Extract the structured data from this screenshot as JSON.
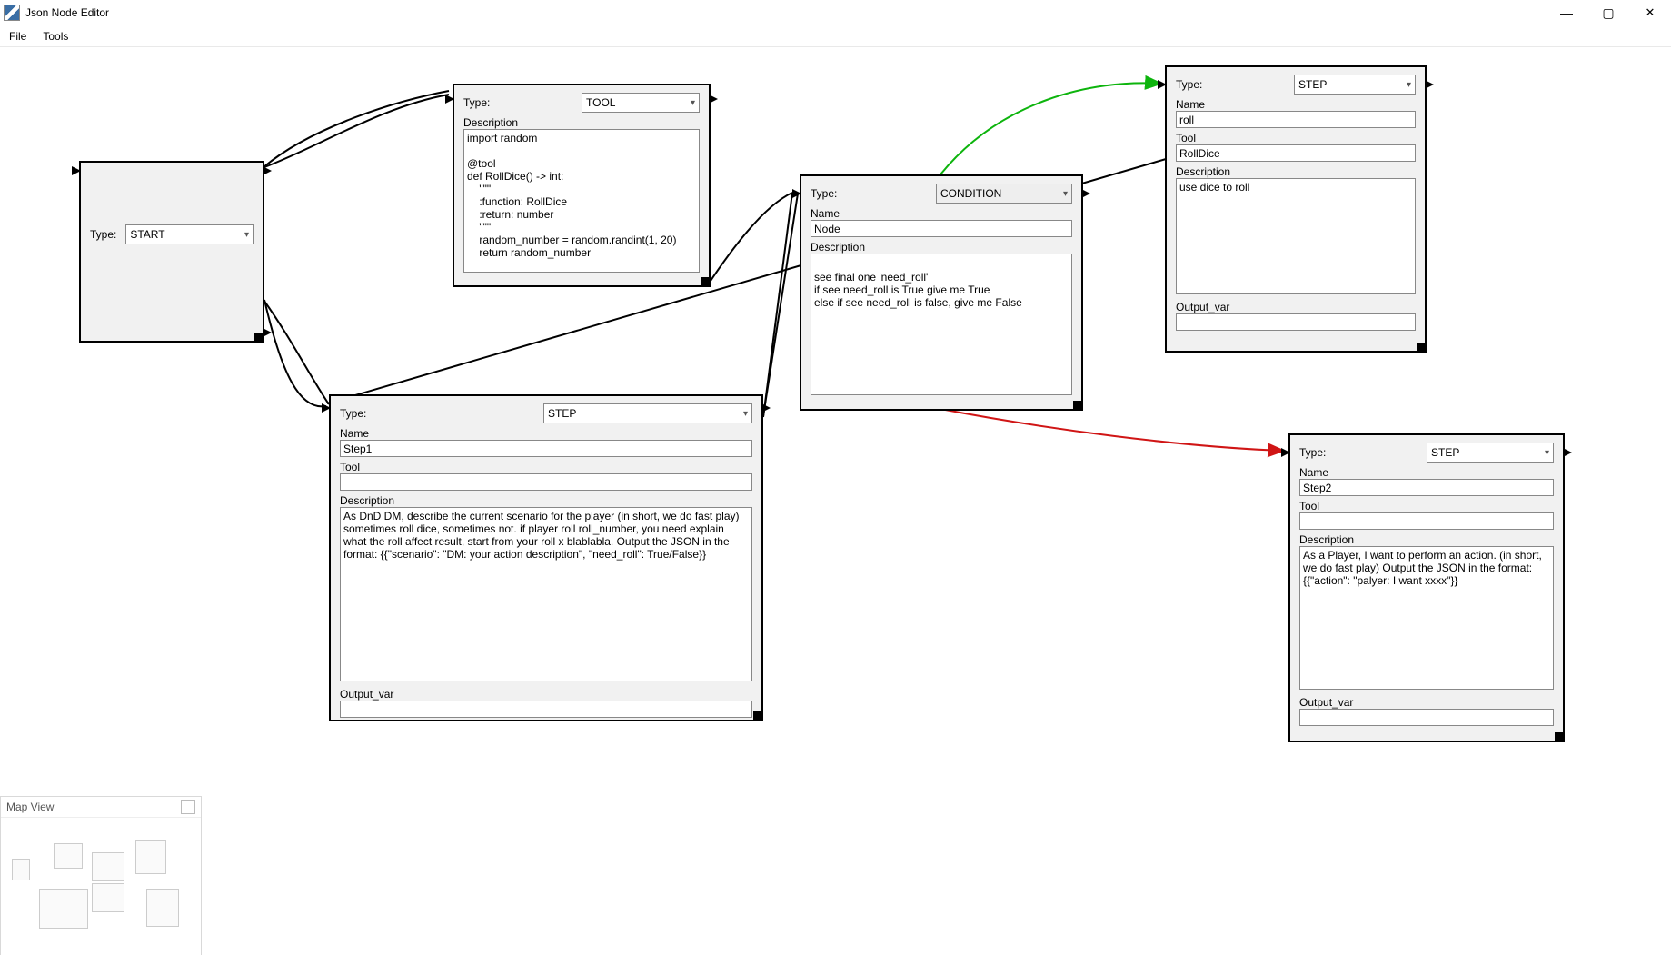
{
  "app": {
    "title": "Json Node Editor"
  },
  "menu": {
    "file": "File",
    "tools": "Tools"
  },
  "labels": {
    "type": "Type:",
    "name": "Name",
    "tool": "Tool",
    "description": "Description",
    "output_var": "Output_var"
  },
  "type_options": {
    "start": "START",
    "tool": "TOOL",
    "condition": "CONDITION",
    "step": "STEP"
  },
  "nodes": {
    "start": {
      "type": "START"
    },
    "tool": {
      "type": "TOOL",
      "description": "import random\n\n@tool\ndef RollDice() -> int:\n    \"\"\"\n    :function: RollDice\n    :return: number\n    \"\"\"\n    random_number = random.randint(1, 20)\n    return random_number"
    },
    "condition": {
      "type": "CONDITION",
      "name": "Node",
      "description": "see final one 'need_roll'\nif see need_roll is True give me True\nelse if see need_roll is false, give me False"
    },
    "step_roll": {
      "type": "STEP",
      "name": "roll",
      "tool": "RollDice",
      "description": "use dice to roll",
      "output_var": ""
    },
    "step1": {
      "type": "STEP",
      "name": "Step1",
      "tool": "",
      "description": "As DnD DM, describe the current scenario for the player (in short, we do fast play) sometimes roll dice, sometimes not. if player roll roll_number, you need explain what the roll affect result, start from your roll x blablabla. Output the JSON in the format: {{\"scenario\": \"DM: your action description\", \"need_roll\": True/False}}",
      "output_var": ""
    },
    "step2": {
      "type": "STEP",
      "name": "Step2",
      "tool": "",
      "description": "As a Player, I want to perform an action. (in short, we do fast play) Output the JSON in the format: {{\"action\": \"palyer: I want xxxx\"}}",
      "output_var": ""
    }
  },
  "mapview": {
    "title": "Map View"
  }
}
